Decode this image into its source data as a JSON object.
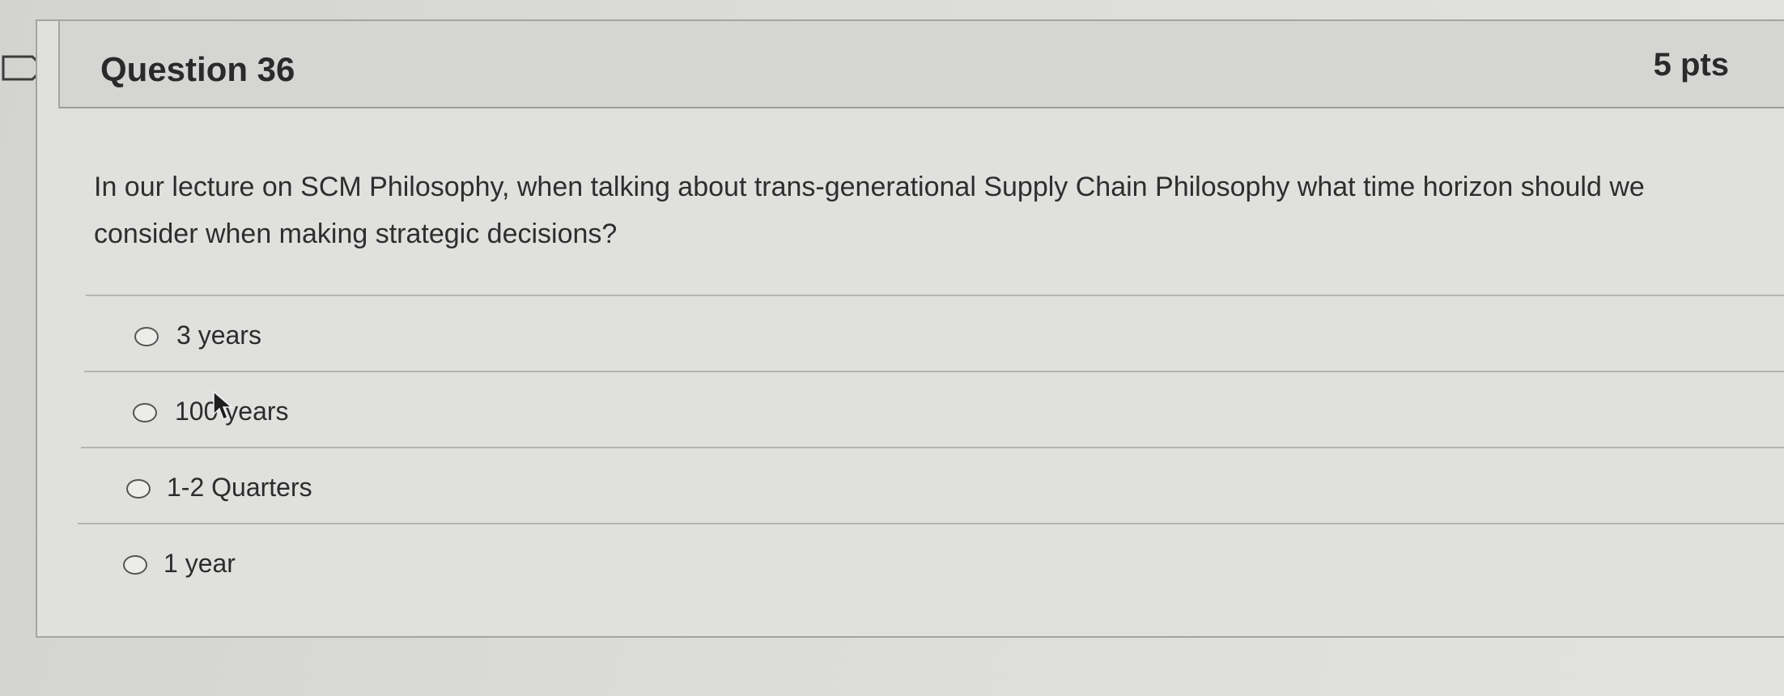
{
  "question": {
    "title": "Question 36",
    "points": "5 pts",
    "text": "In our lecture on SCM Philosophy, when talking about trans-generational Supply Chain Philosophy what time horizon should we consider when making strategic decisions?"
  },
  "answers": [
    {
      "label": "3 years",
      "selected": false
    },
    {
      "label": "100 years",
      "selected": false
    },
    {
      "label": "1-2 Quarters",
      "selected": false
    },
    {
      "label": "1 year",
      "selected": false
    }
  ],
  "icons": {
    "flag": "flag-icon",
    "cursor": "mouse-pointer-icon",
    "radio": "radio-button-icon"
  }
}
